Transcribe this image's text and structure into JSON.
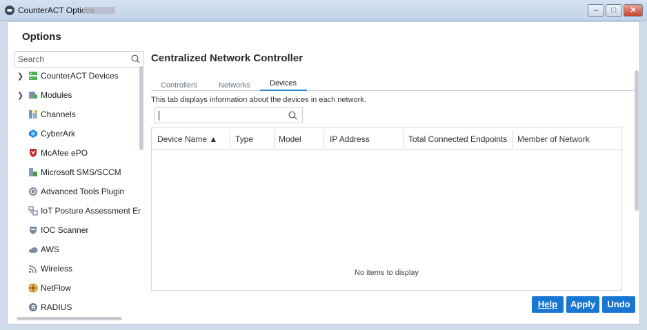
{
  "window": {
    "title": "CounterACT Options",
    "controls": {
      "minimize": "–",
      "maximize": "□",
      "close": "✕"
    }
  },
  "options": {
    "title": "Options",
    "search_placeholder": "Search"
  },
  "sidebar": {
    "items": [
      {
        "label": "CounterACT Devices",
        "icon": "server-icon",
        "expandable": true
      },
      {
        "label": "Modules",
        "icon": "modules-icon",
        "expandable": true
      },
      {
        "label": "Channels",
        "icon": "channels-icon",
        "expandable": false
      },
      {
        "label": "CyberArk",
        "icon": "cyberark-icon",
        "expandable": false
      },
      {
        "label": "McAfee ePO",
        "icon": "mcafee-shield-icon",
        "expandable": false
      },
      {
        "label": "Microsoft SMS/SCCM",
        "icon": "sccm-icon",
        "expandable": false
      },
      {
        "label": "Advanced Tools Plugin",
        "icon": "gear-icon",
        "expandable": false
      },
      {
        "label": "IoT Posture Assessment Eng",
        "icon": "iot-icon",
        "expandable": false
      },
      {
        "label": "IOC Scanner",
        "icon": "shield-icon",
        "expandable": false
      },
      {
        "label": "AWS",
        "icon": "cloud-icon",
        "expandable": false
      },
      {
        "label": "Wireless",
        "icon": "wifi-icon",
        "expandable": false
      },
      {
        "label": "NetFlow",
        "icon": "netflow-icon",
        "expandable": false
      },
      {
        "label": "RADIUS",
        "icon": "radius-icon",
        "expandable": false
      }
    ]
  },
  "panel": {
    "title": "Centralized Network Controller",
    "tabs": [
      "Controllers",
      "Networks",
      "Devices"
    ],
    "active_tab": "Devices",
    "description": "This tab displays information about the devices in each network.",
    "search_value": ""
  },
  "table": {
    "columns": [
      "Device Name ▲",
      "Type",
      "Model",
      "IP Address",
      "Total Connected Endpoints",
      "Member of Network"
    ],
    "empty_message": "No items to display"
  },
  "buttons": {
    "help": "Help",
    "apply": "Apply",
    "undo": "Undo"
  },
  "colors": {
    "accent": "#1976d2",
    "tab_underline": "#2c88d9",
    "title_bar": "#c3d4e8"
  }
}
